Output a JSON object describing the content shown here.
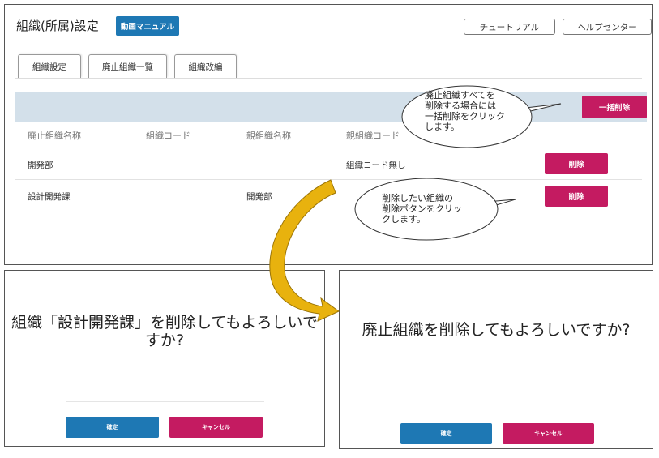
{
  "header": {
    "title": "組織(所属)設定",
    "manual_button": "動画マニュアル",
    "tutorial_button": "チュートリアル",
    "help_button": "ヘルプセンター"
  },
  "tabs": [
    {
      "label": "組織設定"
    },
    {
      "label": "廃止組織一覧"
    },
    {
      "label": "組織改編"
    }
  ],
  "toolbar": {
    "bulk_delete_button": "一括削除"
  },
  "table": {
    "columns": [
      "廃止組織名称",
      "組織コード",
      "親組織名称",
      "親組織コード"
    ],
    "rows": [
      {
        "name": "開発部",
        "code": "",
        "parent_name": "",
        "parent_code": "組織コード無し",
        "delete_label": "削除"
      },
      {
        "name": "設計開発課",
        "code": "",
        "parent_name": "開発部",
        "parent_code": "",
        "delete_label": "削除"
      }
    ]
  },
  "callouts": {
    "bulk": "廃止組織すべてを\n削除する場合には\n一括削除をクリック\nします。",
    "single": "削除したい組織の\n削除ボタンをクリッ\nクします。"
  },
  "dialogs": [
    {
      "message": "組織「設計開発課」を削除してもよろしいですか?",
      "ok": "確定",
      "cancel": "キャンセル"
    },
    {
      "message": "廃止組織を削除してもよろしいですか?",
      "ok": "確定",
      "cancel": "キャンセル"
    }
  ],
  "colors": {
    "primary_blue": "#1e78b4",
    "danger_pink": "#c41b61",
    "action_bar": "#d3e0ea",
    "arrow_gold": "#e8b20e"
  }
}
